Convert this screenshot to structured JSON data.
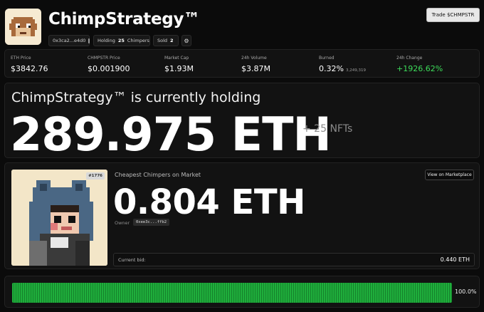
{
  "header": {
    "title": "ChimpStrategy™",
    "address": "0x3ca2...e4d0",
    "holding_label": "Holding",
    "holding_count": "25",
    "holding_unit": "Chimpers",
    "sold_label": "Sold",
    "sold_count": "2",
    "trade_button": "Trade $CHMPSTR",
    "icons": [
      "chimp-logo-icon",
      "copy-icon",
      "gear-icon"
    ]
  },
  "stats": [
    {
      "label": "ETH Price",
      "value": "$3842.76",
      "sub": ""
    },
    {
      "label": "CHMPSTR Price",
      "value": "$0.001900",
      "sub": ""
    },
    {
      "label": "Market Cap",
      "value": "$1.93M",
      "sub": ""
    },
    {
      "label": "24h Volume",
      "value": "$3.87M",
      "sub": ""
    },
    {
      "label": "Burned",
      "value": "0.32%",
      "sub": "3,249,319"
    },
    {
      "label": "24h Change",
      "value": "+1926.62%",
      "sub": ""
    }
  ],
  "holding": {
    "title": "ChimpStrategy™ is currently holding",
    "amount": "289.975 ETH",
    "nfts": "+ 25 NFTs"
  },
  "market": {
    "badge": "#1776",
    "title": "Cheapest Chimpers on Market",
    "button": "View on Marketplace",
    "price": "0.804 ETH",
    "owner_label": "Owner",
    "owner_address": "0xee3c...ffb2",
    "bid_label": "Current bid:",
    "bid_value": "0.440 ETH"
  },
  "progress": {
    "percent_label": "100.0%",
    "value": 1.0
  },
  "colors": {
    "background": "#0b0b0b",
    "card": "#121212",
    "positive": "#3ddc5a",
    "progress": "#1fae3c"
  }
}
